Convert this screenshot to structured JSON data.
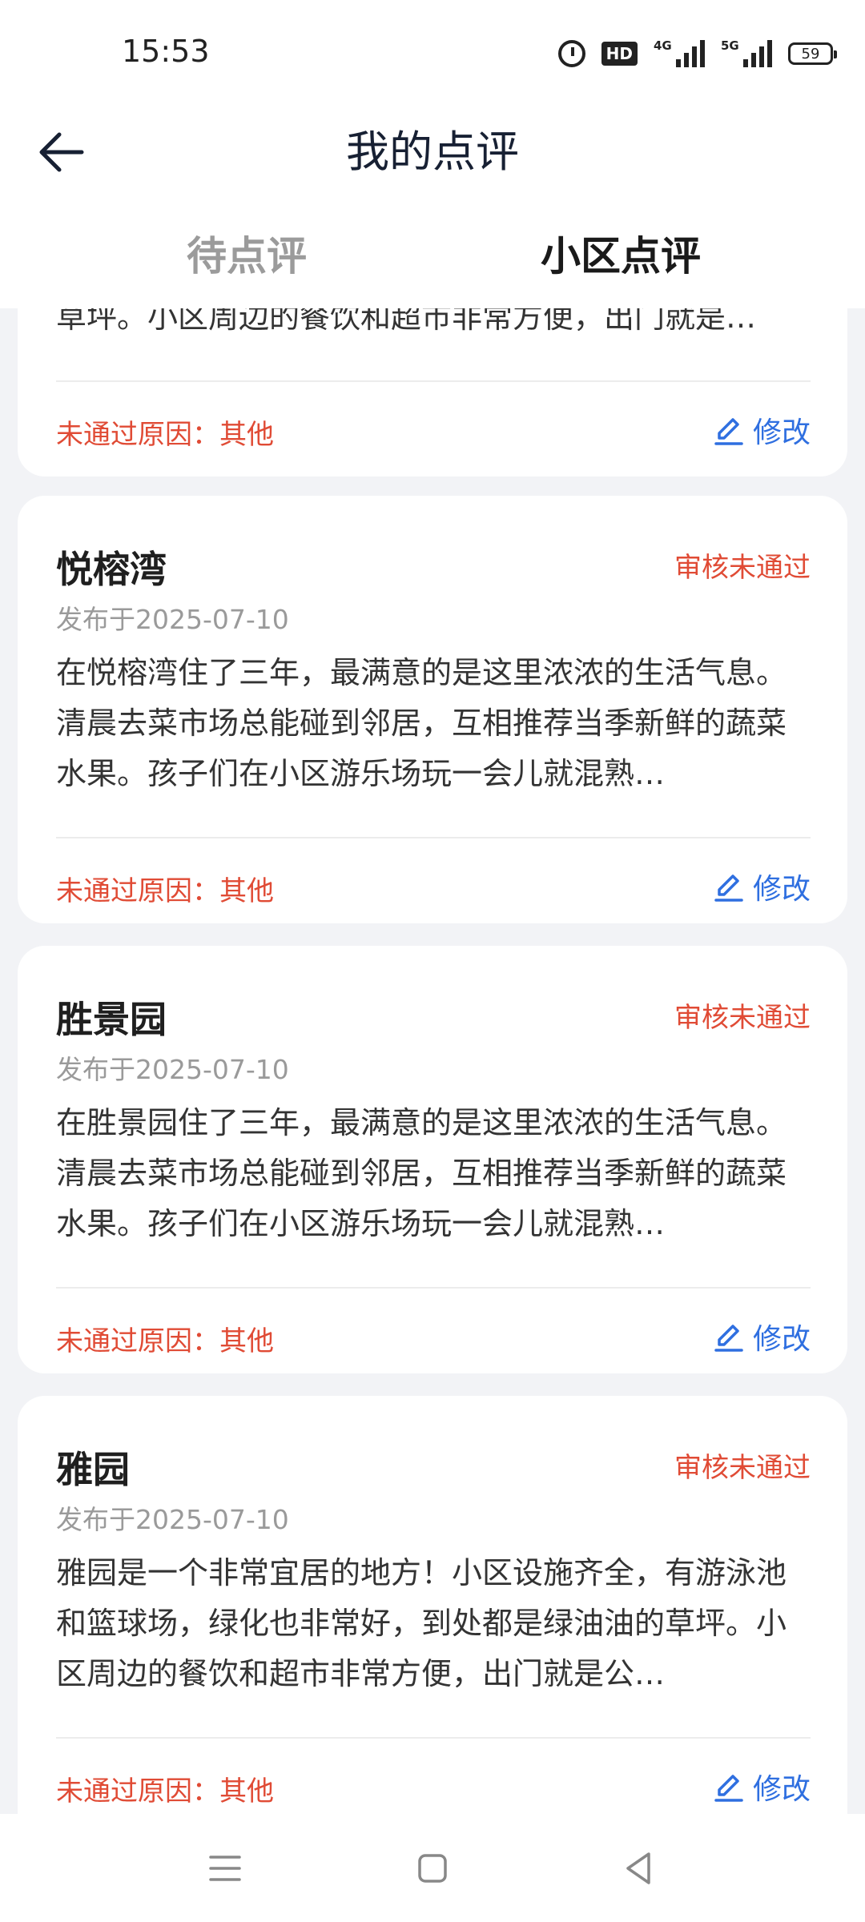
{
  "status_bar": {
    "time": "15:53",
    "hd_label": "HD",
    "sig1_label": "4G",
    "sig2_label": "5G",
    "battery": "59"
  },
  "header": {
    "title": "我的点评"
  },
  "tabs": [
    {
      "label": "待点评",
      "active": false
    },
    {
      "label": "小区点评",
      "active": true
    }
  ],
  "partial_card": {
    "content": "草坪。小区周边的餐饮和超市非常方便，出门就是…",
    "reason": "未通过原因：其他",
    "edit_label": "修改"
  },
  "cards": [
    {
      "name": "悦榕湾",
      "status": "审核未通过",
      "date": "发布于2025-07-10",
      "content": "在悦榕湾住了三年，最满意的是这里浓浓的生活气息。清晨去菜市场总能碰到邻居，互相推荐当季新鲜的蔬菜水果。孩子们在小区游乐场玩一会儿就混熟…",
      "reason": "未通过原因：其他",
      "edit_label": "修改"
    },
    {
      "name": "胜景园",
      "status": "审核未通过",
      "date": "发布于2025-07-10",
      "content": "在胜景园住了三年，最满意的是这里浓浓的生活气息。清晨去菜市场总能碰到邻居，互相推荐当季新鲜的蔬菜水果。孩子们在小区游乐场玩一会儿就混熟…",
      "reason": "未通过原因：其他",
      "edit_label": "修改"
    },
    {
      "name": "雅园",
      "status": "审核未通过",
      "date": "发布于2025-07-10",
      "content": "雅园是一个非常宜居的地方！小区设施齐全，有游泳池和篮球场，绿化也非常好，到处都是绿油油的草坪。小区周边的餐饮和超市非常方便，出门就是公…",
      "reason": "未通过原因：其他",
      "edit_label": "修改"
    }
  ],
  "colors": {
    "accent_blue": "#2f6fe0",
    "reject_red": "#e04b35",
    "page_bg": "#f2f3f6"
  },
  "icons": [
    "back-arrow-icon",
    "alarm-icon",
    "signal-icon",
    "battery-icon",
    "edit-pencil-icon",
    "menu-icon",
    "home-icon",
    "back-triangle-icon"
  ]
}
